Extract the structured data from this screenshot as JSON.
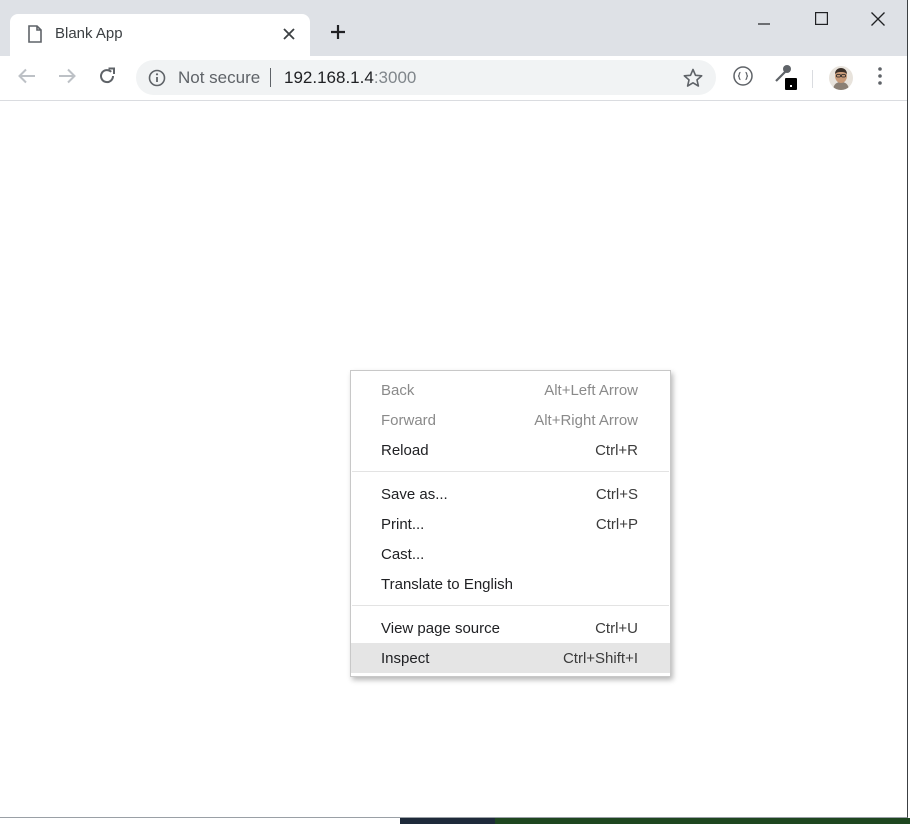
{
  "browser": {
    "tab": {
      "title": "Blank App"
    },
    "toolbar": {
      "security_label": "Not secure",
      "url_host": "192.168.1.4",
      "url_port": ":3000"
    }
  },
  "context_menu": {
    "groups": [
      [
        {
          "label": "Back",
          "shortcut": "Alt+Left Arrow",
          "enabled": false
        },
        {
          "label": "Forward",
          "shortcut": "Alt+Right Arrow",
          "enabled": false
        },
        {
          "label": "Reload",
          "shortcut": "Ctrl+R",
          "enabled": true
        }
      ],
      [
        {
          "label": "Save as...",
          "shortcut": "Ctrl+S",
          "enabled": true
        },
        {
          "label": "Print...",
          "shortcut": "Ctrl+P",
          "enabled": true
        },
        {
          "label": "Cast...",
          "shortcut": "",
          "enabled": true
        },
        {
          "label": "Translate to English",
          "shortcut": "",
          "enabled": true
        }
      ],
      [
        {
          "label": "View page source",
          "shortcut": "Ctrl+U",
          "enabled": true
        },
        {
          "label": "Inspect",
          "shortcut": "Ctrl+Shift+I",
          "enabled": true,
          "highlighted": true
        }
      ]
    ]
  },
  "icons": {
    "tab": "page-icon",
    "tab_close": "close-icon",
    "new_tab": "plus-icon",
    "minimize": "minimize-icon",
    "maximize": "maximize-icon",
    "close_window": "close-icon",
    "back": "arrow-left-icon",
    "forward": "arrow-right-icon",
    "reload": "reload-icon",
    "site_info": "info-icon",
    "bookmark": "star-icon",
    "extension_1": "code-braces-icon",
    "extension_2": "eyedropper-icon",
    "profile": "avatar",
    "menu": "kebab-menu-icon"
  },
  "colors": {
    "tab_strip": "#dee1e6",
    "omnibox": "#f1f3f4",
    "menu_highlight": "#e5e5e5",
    "disabled_text": "#8a8a8a"
  }
}
